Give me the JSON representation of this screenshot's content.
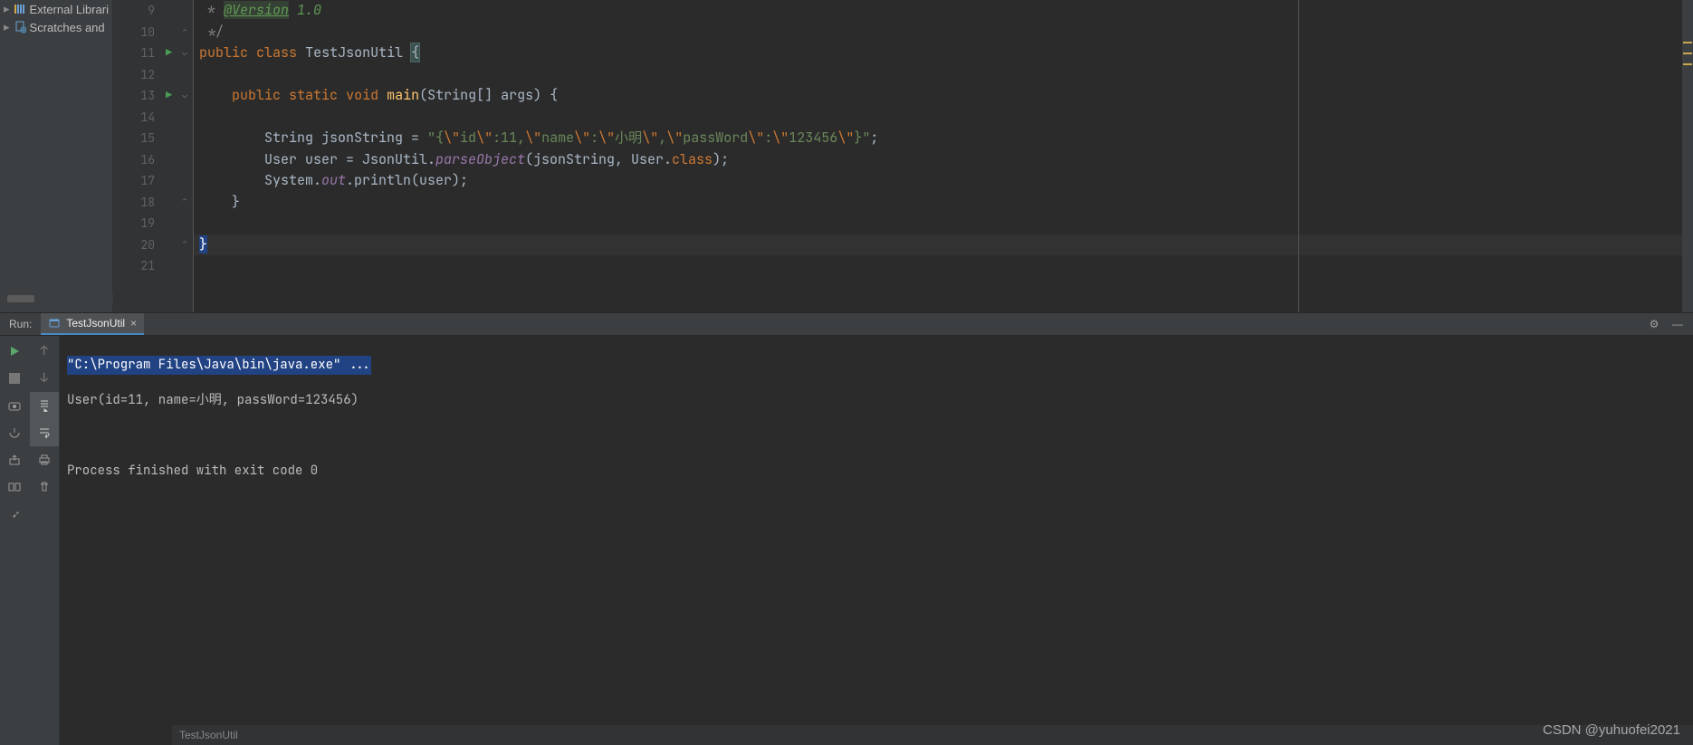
{
  "project_tree": {
    "items": [
      {
        "label": "External Librari",
        "icon": "library"
      },
      {
        "label": "Scratches and",
        "icon": "scratches"
      }
    ]
  },
  "editor": {
    "file_breadcrumb": "TestJsonUtil",
    "first_line_number": 9,
    "lines": [
      {
        "n": 9,
        "raw": "     * @Version 1.0"
      },
      {
        "n": 10,
        "raw": "     */"
      },
      {
        "n": 11,
        "raw": "    public class TestJsonUtil {"
      },
      {
        "n": 12,
        "raw": ""
      },
      {
        "n": 13,
        "raw": "        public static void main(String[] args) {"
      },
      {
        "n": 14,
        "raw": ""
      },
      {
        "n": 15,
        "raw": "            String jsonString = \"{\\\"id\\\":11,\\\"name\\\":\\\"小明\\\",\\\"passWord\\\":\\\"123456\\\"}\";"
      },
      {
        "n": 16,
        "raw": "            User user = JsonUtil.parseObject(jsonString, User.class);"
      },
      {
        "n": 17,
        "raw": "            System.out.println(user);"
      },
      {
        "n": 18,
        "raw": "        }"
      },
      {
        "n": 19,
        "raw": ""
      },
      {
        "n": 20,
        "raw": "    }"
      },
      {
        "n": 21,
        "raw": ""
      }
    ],
    "caret_line": 20,
    "run_gutter_lines": [
      11,
      13
    ],
    "fold_marks": {
      "open": [
        11,
        13
      ],
      "close": [
        10,
        18,
        20
      ]
    }
  },
  "run": {
    "title": "Run:",
    "tab_label": "TestJsonUtil",
    "output": [
      "\"C:\\Program Files\\Java\\bin\\java.exe\" ...",
      "User(id=11, name=小明, passWord=123456)",
      "",
      "Process finished with exit code 0"
    ],
    "side_buttons": [
      "run",
      "arrow-up",
      "stop",
      "arrow-down",
      "camera",
      "scroll-to-end",
      "toggle-break",
      "soft-wrap",
      "export",
      "print",
      "layout",
      "trash",
      "pin"
    ]
  },
  "icons": {
    "gear": "⚙",
    "minimize": "—",
    "close": "×",
    "chevron_right": "▸"
  },
  "watermark": "CSDN @yuhuofei2021",
  "colors": {
    "keyword": "#cc7832",
    "string": "#6a8759",
    "method": "#ffc66d",
    "field": "#9876aa",
    "number": "#6897bb",
    "bg": "#2b2b2b"
  }
}
